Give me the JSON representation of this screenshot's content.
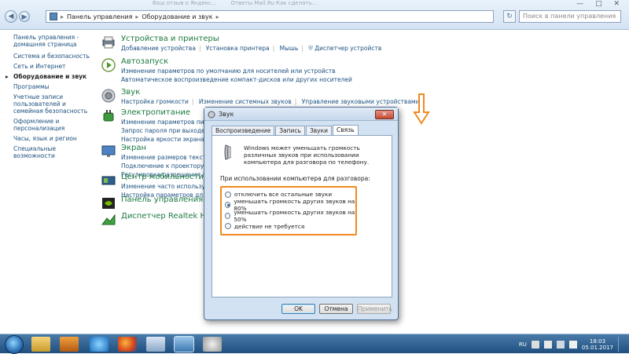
{
  "window": {
    "ghost_tabs": [
      "Ваш отзыв о Яндекс...",
      "Ответы Mail.Ru Как сделать..."
    ],
    "controls": "— □ ✕"
  },
  "address": {
    "back_icon": "back-arrow-icon",
    "forward_icon": "forward-arrow-icon",
    "crumbs": [
      "Панель управления",
      "Оборудование и звук"
    ],
    "search_placeholder": "Поиск в панели управления",
    "refresh_icon": "refresh-icon"
  },
  "leftnav": {
    "items": [
      "Панель управления - домашняя страница",
      "Система и безопасность",
      "Сеть и Интернет",
      "Оборудование и звук",
      "Программы",
      "Учетные записи пользователей и семейная безопасность",
      "Оформление и персонализация",
      "Часы, язык и регион",
      "Специальные возможности"
    ],
    "current_index": 3
  },
  "categories": [
    {
      "title": "Устройства и принтеры",
      "lines": [
        [
          "Добавление устройства",
          "Установка принтера",
          "Мышь",
          "Диспетчер устройств"
        ]
      ],
      "icon": "printer-icon"
    },
    {
      "title": "Автозапуск",
      "lines": [
        [
          "Изменение параметров по умолчанию для носителей или устройств"
        ],
        [
          "Автоматическое воспроизведение компакт-дисков или других носителей"
        ]
      ],
      "icon": "autoplay-icon"
    },
    {
      "title": "Звук",
      "lines": [
        [
          "Настройка громкости",
          "Изменение системных звуков",
          "Управление звуковыми устройствами"
        ]
      ],
      "icon": "speaker-icon"
    },
    {
      "title": "Электропитание",
      "lines": [
        [
          "Изменение параметров питания"
        ],
        [
          "Запрос пароля при выходе из"
        ],
        [
          "Настройка яркости экрана"
        ]
      ],
      "icon": "power-icon"
    },
    {
      "title": "Экран",
      "lines": [
        [
          "Изменение размеров текста и других"
        ],
        [
          "Подключение к проектору"
        ],
        [
          "Регулировка разрешения экрана"
        ]
      ],
      "icon": "display-icon"
    },
    {
      "title": "Центр мобильности Windo",
      "lines": [
        [
          "Изменение часто используемых"
        ],
        [
          "Настройка параметров для"
        ]
      ],
      "icon": "mobility-center-icon"
    },
    {
      "title": "Панель управления NVIDI",
      "lines": [],
      "icon": "nvidia-icon"
    },
    {
      "title": "Диспетчер Realtek HD",
      "lines": [],
      "icon": "realtek-icon"
    }
  ],
  "dialog": {
    "title": "Звук",
    "close_label": "✕",
    "tabs": [
      "Воспроизведение",
      "Запись",
      "Звуки",
      "Связь"
    ],
    "active_tab": 3,
    "description": "Windows может уменьшать громкость различных звуков при использовании компьютера для разговора по телефону.",
    "prompt": "При использовании компьютера для разговора:",
    "options": [
      "отключить все остальные звуки",
      "уменьшать громкость других звуков на 80%",
      "уменьшать громкость других звуков на 50%",
      "действие не требуется"
    ],
    "selected_option": 1,
    "buttons": {
      "ok": "OK",
      "cancel": "Отмена",
      "apply": "Применить"
    }
  },
  "taskbar": {
    "icons": [
      "windows-explorer-icon",
      "media-player-icon",
      "internet-explorer-icon",
      "firefox-icon",
      "image-viewer-icon",
      "control-panel-icon",
      "disc-icon"
    ],
    "language": "RU",
    "time": "18:03",
    "date": "05.01.2017"
  },
  "colors": {
    "highlight_orange": "#f28a20",
    "link_blue": "#1c5180",
    "category_green": "#1b7a3f"
  }
}
